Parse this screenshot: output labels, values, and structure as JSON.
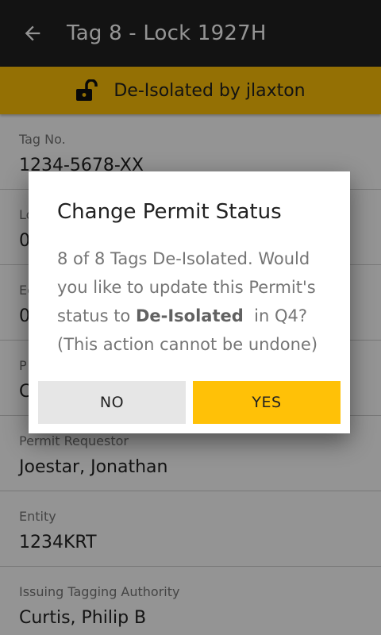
{
  "appbar": {
    "title": "Tag 8 - Lock 1927H",
    "back_icon": "arrow-back-icon"
  },
  "banner": {
    "text": "De-Isolated by jlaxton",
    "icon": "unlocked-lock-icon",
    "color": "#FFC107"
  },
  "fields": [
    {
      "label": "Tag No.",
      "value": "1234-5678-XX"
    },
    {
      "label": "Lo",
      "value": "0"
    },
    {
      "label": "Ec",
      "value": "0"
    },
    {
      "label": "P",
      "value": "C"
    },
    {
      "label": "Permit Requestor",
      "value": "Joestar, Jonathan"
    },
    {
      "label": "Entity",
      "value": "1234KRT"
    },
    {
      "label": "Issuing Tagging Authority",
      "value": "Curtis, Philip B"
    }
  ],
  "dialog": {
    "title": "Change Permit Status",
    "body_prefix": "8 of 8 Tags De-Isolated. Would you like to update this Permit's status to ",
    "body_bold": "De-Isolated",
    "body_suffix": "  in Q4? (This action cannot be undone)",
    "no_label": "NO",
    "yes_label": "YES"
  }
}
